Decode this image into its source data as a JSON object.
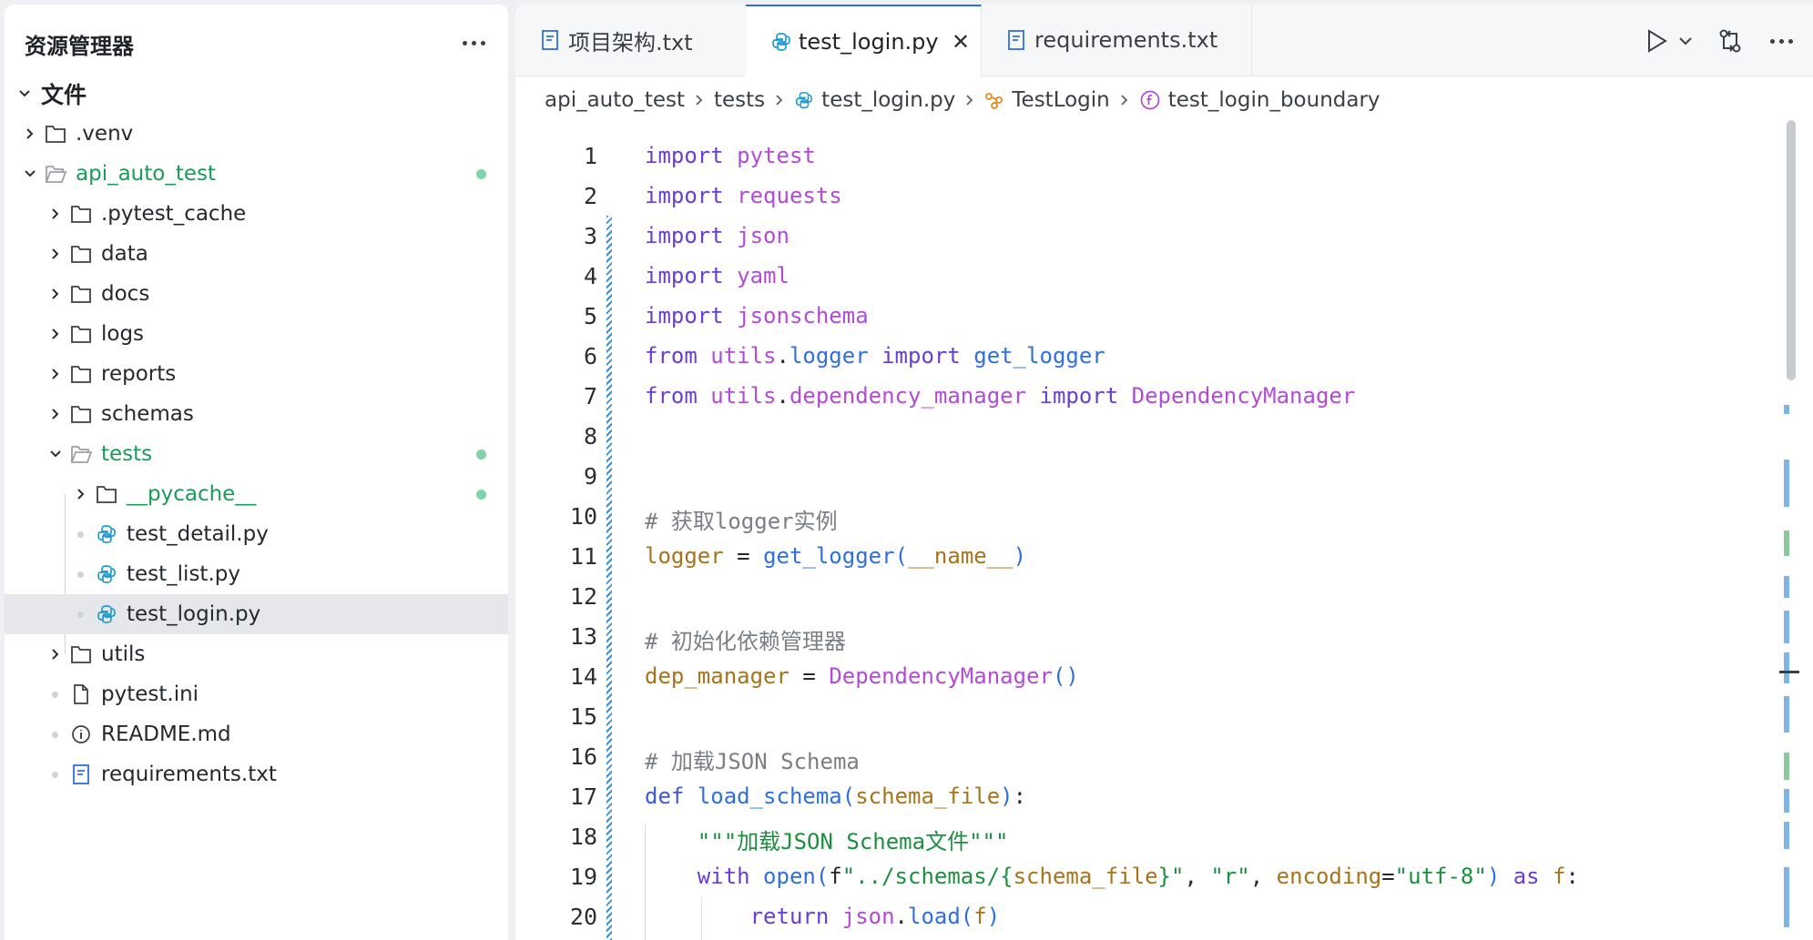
{
  "sidebar": {
    "title": "资源管理器",
    "section": "文件",
    "items": [
      {
        "label": ".venv",
        "type": "folder"
      },
      {
        "label": "api_auto_test",
        "type": "folder-open"
      },
      {
        "label": ".pytest_cache",
        "type": "folder"
      },
      {
        "label": "data",
        "type": "folder"
      },
      {
        "label": "docs",
        "type": "folder"
      },
      {
        "label": "logs",
        "type": "folder"
      },
      {
        "label": "reports",
        "type": "folder"
      },
      {
        "label": "schemas",
        "type": "folder"
      },
      {
        "label": "tests",
        "type": "folder-open"
      },
      {
        "label": "__pycache__",
        "type": "folder"
      },
      {
        "label": "test_detail.py",
        "type": "python"
      },
      {
        "label": "test_list.py",
        "type": "python"
      },
      {
        "label": "test_login.py",
        "type": "python"
      },
      {
        "label": "utils",
        "type": "folder"
      },
      {
        "label": "pytest.ini",
        "type": "file"
      },
      {
        "label": "README.md",
        "type": "info"
      },
      {
        "label": "requirements.txt",
        "type": "text"
      }
    ]
  },
  "tabs": [
    {
      "label": "项目架构.txt",
      "active": false
    },
    {
      "label": "test_login.py",
      "active": true
    },
    {
      "label": "requirements.txt",
      "active": false
    }
  ],
  "breadcrumb": [
    "api_auto_test",
    "tests",
    "test_login.py",
    "TestLogin",
    "test_login_boundary"
  ],
  "line_numbers": [
    "1",
    "2",
    "3",
    "4",
    "5",
    "6",
    "7",
    "8",
    "9",
    "10",
    "11",
    "12",
    "13",
    "14",
    "15",
    "16",
    "17",
    "18",
    "19",
    "20"
  ],
  "colors": {
    "accent": "#2f6fe0",
    "folder_modified": "#1a9b58",
    "python_icon": "#1f9bd1"
  }
}
